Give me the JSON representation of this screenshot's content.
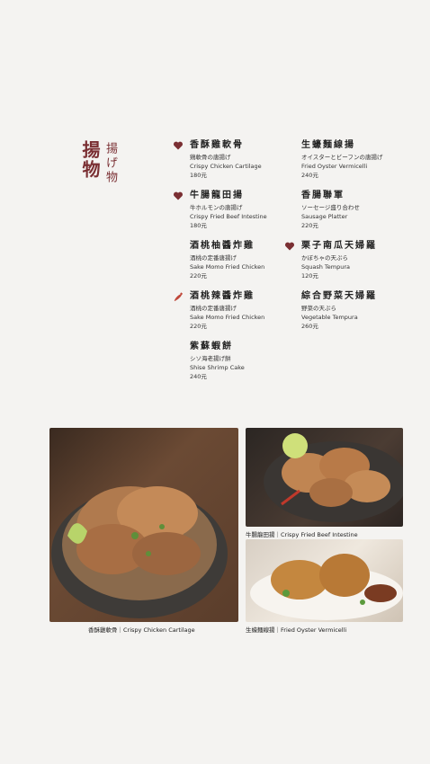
{
  "section": {
    "title_cn": "揚物",
    "title_jp": "揚げ物"
  },
  "menu": {
    "left": [
      {
        "name": "香酥雞軟骨",
        "jp": "鶏軟骨の唐揚げ",
        "en": "Crispy Chicken Cartilage",
        "price": "180元",
        "mark": "heart-icon"
      },
      {
        "name": "牛腸龍田揚",
        "jp": "牛ホルモンの唐揚げ",
        "en": "Crispy Fried Beef Intestine",
        "price": "180元",
        "mark": "heart-icon"
      },
      {
        "name": "酒桃柚醬炸雞",
        "jp": "酒桃の定番唐揚げ",
        "en": "Sake Momo Fried Chicken",
        "price": "220元",
        "mark": ""
      },
      {
        "name": "酒桃辣醬炸雞",
        "jp": "酒桃の定番唐揚げ",
        "en": "Sake Momo Fried Chicken",
        "price": "220元",
        "mark": "chili-icon"
      },
      {
        "name": "紫蘇蝦餅",
        "jp": "シソ海老揚げ餅",
        "en": "Shise Shrimp Cake",
        "price": "240元",
        "mark": ""
      }
    ],
    "right": [
      {
        "name": "生蠔麵線揚",
        "jp": "オイスターとビーフンの唐揚げ",
        "en": "Fried Oyster Vermicelli",
        "price": "240元",
        "mark": ""
      },
      {
        "name": "香腸聯軍",
        "jp": "ソーセージ盛り合わせ",
        "en": "Sausage Platter",
        "price": "220元",
        "mark": ""
      },
      {
        "name": "栗子南瓜天婦羅",
        "jp": "かぼちゃの天ぷら",
        "en": "Squash Tempura",
        "price": "120元",
        "mark": "heart-icon"
      },
      {
        "name": "綜合野菜天婦羅",
        "jp": "野菜の天ぷら",
        "en": "Vegetable Tempura",
        "price": "260元",
        "mark": ""
      }
    ]
  },
  "captions": {
    "main": "香酥雞軟骨｜Crispy Chicken Cartilage",
    "top_right": "牛腸龍田揚｜Crispy Fried Beef Intestine",
    "bottom_right": "生蠔麵線揚｜Fried Oyster Vermicelli"
  },
  "colors": {
    "accent": "#7a2f33",
    "chili": "#c0473a",
    "background": "#f4f3f1"
  }
}
